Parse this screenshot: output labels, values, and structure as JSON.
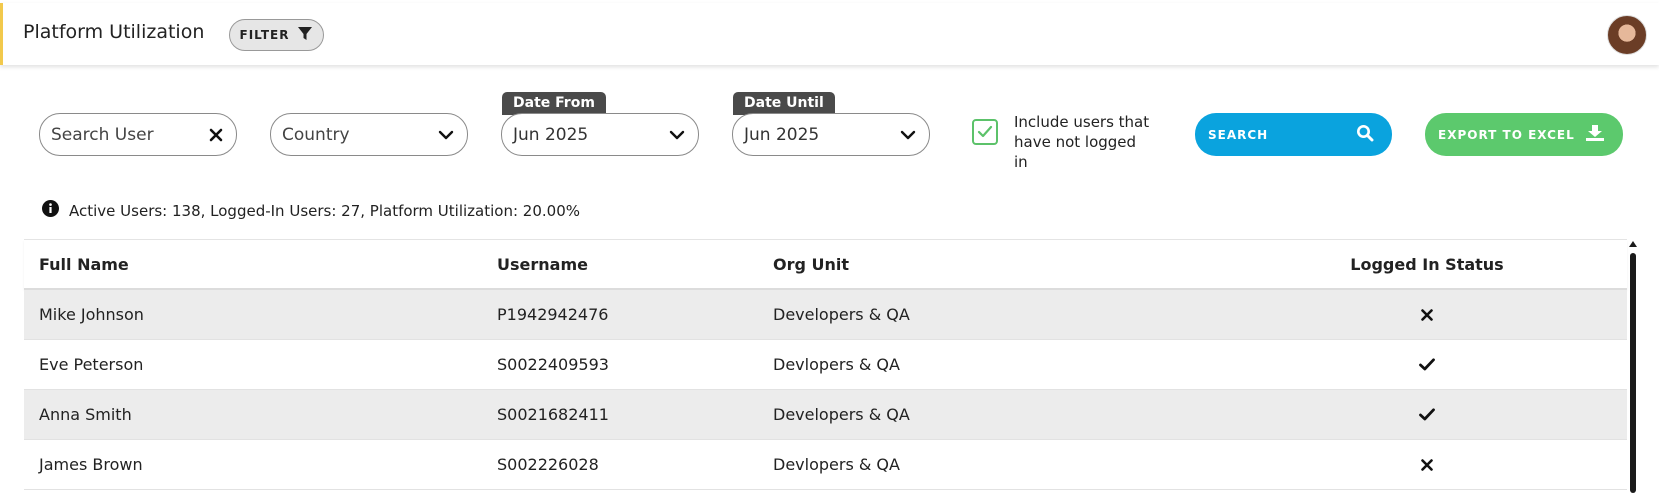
{
  "header": {
    "title": "Platform Utilization",
    "filter_label": "FILTER",
    "accent_color": "#f2c94c"
  },
  "filters": {
    "search_user_placeholder": "Search User",
    "country_placeholder": "Country",
    "date_from": {
      "tag": "Date From",
      "value": "Jun 2025"
    },
    "date_until": {
      "tag": "Date Until",
      "value": "Jun 2025"
    },
    "include_not_logged": {
      "label": "Include users that have not logged in",
      "checked": true
    },
    "search_button": "SEARCH",
    "export_button": "EXPORT TO EXCEL",
    "search_color": "#0aa3de",
    "export_color": "#5cc96d"
  },
  "summary": "Active Users: 138, Logged-In Users: 27, Platform Utilization: 20.00%",
  "table": {
    "headers": [
      "Full Name",
      "Username",
      "Org Unit",
      "Logged In Status"
    ],
    "rows": [
      {
        "full_name": "Mike Johnson",
        "username": "P1942942476",
        "org_unit": "Developers & QA",
        "logged_in": false
      },
      {
        "full_name": "Eve Peterson",
        "username": "S0022409593",
        "org_unit": "Devlopers & QA",
        "logged_in": true
      },
      {
        "full_name": "Anna Smith",
        "username": "S0021682411",
        "org_unit": "Developers & QA",
        "logged_in": true
      },
      {
        "full_name": "James Brown",
        "username": "S002226028",
        "org_unit": "Devlopers & QA",
        "logged_in": false
      }
    ]
  }
}
